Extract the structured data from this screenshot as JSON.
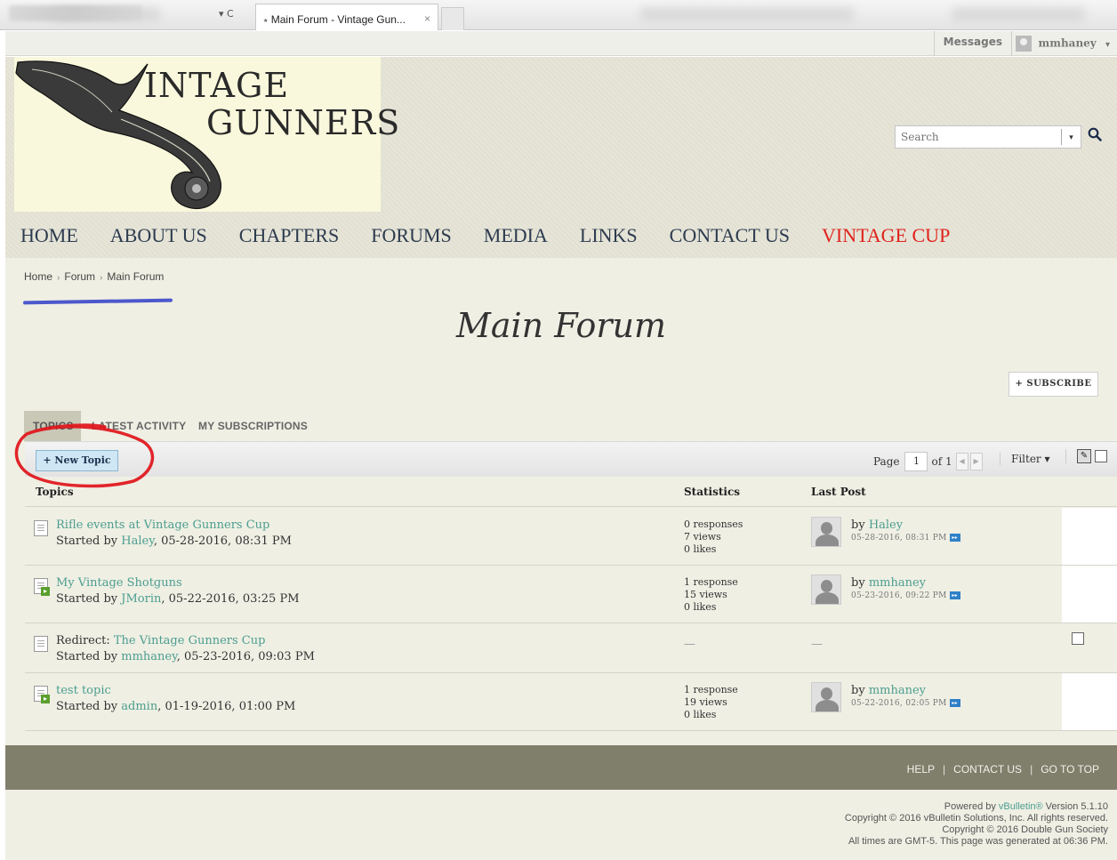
{
  "browser": {
    "reload_glyph": "▾ C",
    "tab_title": "Main Forum - Vintage Gun...",
    "tab_close": "×"
  },
  "topbar": {
    "messages_label": "Messages",
    "username": "mmhaney",
    "user_menu_glyph": "▾"
  },
  "header": {
    "logo_line1": "INTAGE",
    "logo_line2": "GUNNERS",
    "search_placeholder": "Search",
    "search_dropdown_glyph": "▾",
    "search_button_glyph": "🔍"
  },
  "nav": {
    "items": [
      "HOME",
      "ABOUT US",
      "CHAPTERS",
      "FORUMS",
      "MEDIA",
      "LINKS",
      "CONTACT US",
      "VINTAGE CUP"
    ],
    "highlight_color": "#e0211c"
  },
  "breadcrumb": {
    "items": [
      "Home",
      "Forum",
      "Main Forum"
    ],
    "separator": "›"
  },
  "page": {
    "title": "Main Forum",
    "subscribe_label": "+ SUBSCRIBE"
  },
  "tabs": {
    "items": [
      "TOPICS",
      "LATEST ACTIVITY",
      "MY SUBSCRIPTIONS"
    ]
  },
  "toolbar": {
    "new_topic_label": "+ New Topic",
    "page_label": "Page",
    "page_value": "1",
    "page_of": "of 1",
    "prev_glyph": "◀",
    "next_glyph": "▶",
    "filter_label": "Filter ▾",
    "edit_glyph": "✎"
  },
  "table": {
    "headers": {
      "topics": "Topics",
      "statistics": "Statistics",
      "last_post": "Last Post"
    },
    "rows": [
      {
        "prefix": "",
        "title": "Rifle events at Vintage Gunners Cup",
        "started_prefix": "Started by",
        "author": "Haley",
        "date": ", 05-28-2016, 08:31 PM",
        "stats": [
          "0 responses",
          "7 views",
          "0 likes"
        ],
        "last_by": "by",
        "last_user": "Haley",
        "last_date": "05-28-2016, 08:31 PM",
        "new": false
      },
      {
        "prefix": "",
        "title": "My Vintage Shotguns",
        "started_prefix": "Started by",
        "author": "JMorin",
        "date": ", 05-22-2016, 03:25 PM",
        "stats": [
          "1 response",
          "15 views",
          "0 likes"
        ],
        "last_by": "by",
        "last_user": "mmhaney",
        "last_date": "05-23-2016, 09:22 PM",
        "new": true
      },
      {
        "prefix": "Redirect: ",
        "title": "The Vintage Gunners Cup",
        "started_prefix": "Started by",
        "author": "mmhaney",
        "date": ", 05-23-2016, 09:03 PM",
        "stats_dash": "—",
        "last_dash": "—",
        "new": false
      },
      {
        "prefix": "",
        "title": "test topic",
        "started_prefix": "Started by",
        "author": "admin",
        "date": ", 01-19-2016, 01:00 PM",
        "stats": [
          "1 response",
          "19 views",
          "0 likes"
        ],
        "last_by": "by",
        "last_user": "mmhaney",
        "last_date": "05-22-2016, 02:05 PM",
        "new": true
      }
    ],
    "go_glyph": "▸▸"
  },
  "footer": {
    "links": [
      "HELP",
      "CONTACT US",
      "GO TO TOP"
    ],
    "divider": "|",
    "powered_prefix": "Powered by ",
    "powered_brand": "vBulletin®",
    "powered_suffix": " Version 5.1.10",
    "copyright1": "Copyright © 2016 vBulletin Solutions, Inc. All rights reserved.",
    "copyright2": "Copyright © 2016 Double Gun Society",
    "times": "All times are GMT-5. This page was generated at 06:36 PM."
  },
  "colors": {
    "accent_link": "#4c9e8f",
    "annotation_red": "#e0141a",
    "annotation_blue": "#3a47c8",
    "footer_bar": "#807f6c"
  }
}
